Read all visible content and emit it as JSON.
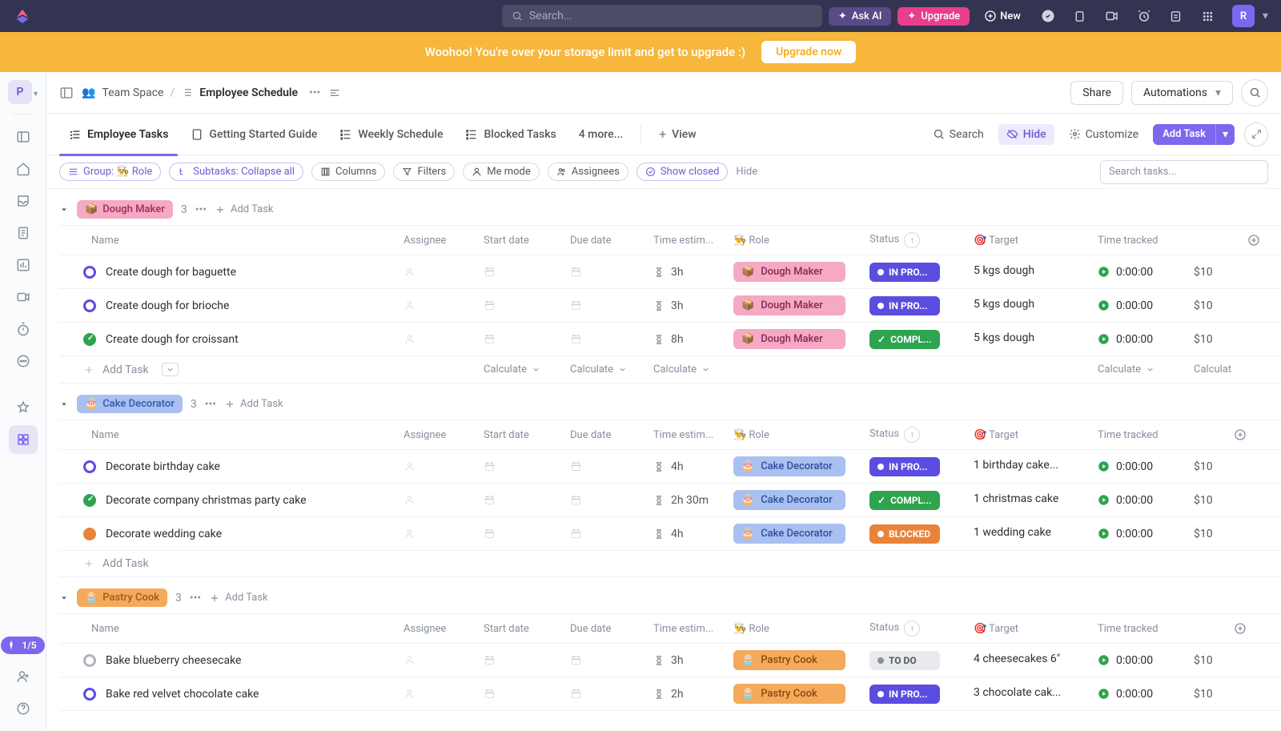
{
  "topbar": {
    "search_placeholder": "Search...",
    "ask_ai": "Ask AI",
    "upgrade": "Upgrade",
    "new": "New",
    "avatar_initial": "R"
  },
  "banner": {
    "text": "Woohoo! You're over your storage limit and get to upgrade :)",
    "button": "Upgrade now"
  },
  "rail": {
    "workspace_initial": "P",
    "onboard": "1/5"
  },
  "header": {
    "space": "Team Space",
    "title": "Employee Schedule",
    "share": "Share",
    "automations": "Automations"
  },
  "tabs": {
    "t0": "Employee Tasks",
    "t1": "Getting Started Guide",
    "t2": "Weekly Schedule",
    "t3": "Blocked Tasks",
    "more": "4 more...",
    "view": "View",
    "search": "Search",
    "hide": "Hide",
    "customize": "Customize",
    "add_task": "Add Task"
  },
  "filters": {
    "group": "Group: 👨‍🍳 Role",
    "subtasks": "Subtasks: Collapse all",
    "columns": "Columns",
    "filters": "Filters",
    "me": "Me mode",
    "assignees": "Assignees",
    "show_closed": "Show closed",
    "hide": "Hide",
    "search_placeholder": "Search tasks..."
  },
  "columns": {
    "name": "Name",
    "assignee": "Assignee",
    "start": "Start date",
    "due": "Due date",
    "time_est": "Time estim...",
    "role": "👨‍🍳 Role",
    "status": "Status",
    "target": "🎯 Target",
    "tracked": "Time tracked"
  },
  "common": {
    "add_task": "Add Task",
    "calculate": "Calculate",
    "tracked_zero": "0:00:00",
    "cost": "$10"
  },
  "groups": [
    {
      "emoji": "📦",
      "label": "Dough Maker",
      "role_class": "role-dough",
      "rc_class": "rc-dough",
      "count": "3",
      "rows": [
        {
          "name": "Create dough for baguette",
          "est": "3h",
          "status": "IN PRO...",
          "status_class": "sp-inprog",
          "dot": "dot-inprogress",
          "target": "5 kgs dough"
        },
        {
          "name": "Create dough for brioche",
          "est": "3h",
          "status": "IN PRO...",
          "status_class": "sp-inprog",
          "dot": "dot-inprogress",
          "target": "5 kgs dough"
        },
        {
          "name": "Create dough for croissant",
          "est": "8h",
          "status": "COMPL...",
          "status_class": "sp-complete",
          "dot": "dot-complete",
          "target": "5 kgs dough"
        }
      ],
      "show_calc": true
    },
    {
      "emoji": "🎂",
      "label": "Cake Decorator",
      "role_class": "role-cake",
      "rc_class": "rc-cake",
      "count": "3",
      "rows": [
        {
          "name": "Decorate birthday cake",
          "est": "4h",
          "status": "IN PRO...",
          "status_class": "sp-inprog",
          "dot": "dot-inprogress",
          "target": "1 birthday cake..."
        },
        {
          "name": "Decorate company christmas party cake",
          "est": "2h 30m",
          "status": "COMPL...",
          "status_class": "sp-complete",
          "dot": "dot-complete",
          "target": "1 christmas cake"
        },
        {
          "name": "Decorate wedding cake",
          "est": "4h",
          "status": "BLOCKED",
          "status_class": "sp-blocked",
          "dot": "dot-blocked",
          "target": "1 wedding cake"
        }
      ],
      "show_calc": false
    },
    {
      "emoji": "🧁",
      "label": "Pastry Cook",
      "role_class": "role-pastry",
      "rc_class": "rc-pastry",
      "count": "3",
      "rows": [
        {
          "name": "Bake blueberry cheesecake",
          "est": "3h",
          "status": "TO DO",
          "status_class": "sp-todo",
          "dot": "dot-todo",
          "target": "4 cheesecakes 6\""
        },
        {
          "name": "Bake red velvet chocolate cake",
          "est": "2h",
          "status": "IN PRO...",
          "status_class": "sp-inprog",
          "dot": "dot-inprogress",
          "target": "3 chocolate cak..."
        }
      ],
      "show_calc": false
    }
  ]
}
